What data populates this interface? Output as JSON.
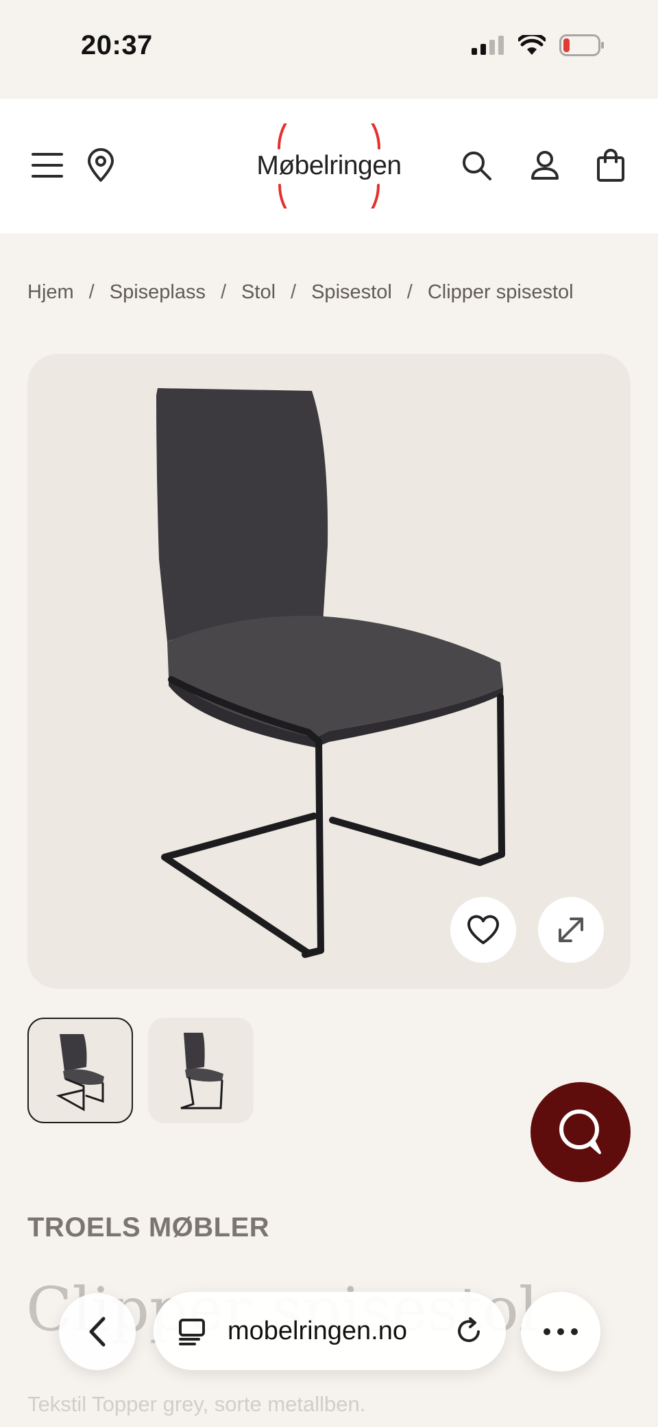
{
  "status_bar": {
    "time": "20:37",
    "icons": [
      "cellular-signal-icon",
      "wifi-icon",
      "battery-low-icon"
    ]
  },
  "header": {
    "menu_icon": "hamburger-menu-icon",
    "location_icon": "location-pin-icon",
    "logo_text": "Møbelringen",
    "search_icon": "search-icon",
    "account_icon": "user-icon",
    "cart_icon": "shopping-bag-icon"
  },
  "breadcrumb": [
    "Hjem",
    "Spiseplass",
    "Stol",
    "Spisestol",
    "Clipper spisestol"
  ],
  "gallery": {
    "favorite_icon": "heart-icon",
    "expand_icon": "expand-arrows-icon",
    "thumbnails": 2,
    "active_thumbnail": 1
  },
  "chat": {
    "icon": "chat-bubble-icon"
  },
  "product": {
    "brand": "TROELS MØBLER",
    "title": "Clipper spisestol",
    "description": "Tekstil Topper grey, sorte metallben."
  },
  "browser": {
    "url": "mobelringen.no",
    "back_icon": "chevron-left-icon",
    "tabs_icon": "reader-icon",
    "reload_icon": "reload-icon",
    "more_icon": "more-dots-icon"
  },
  "colors": {
    "page_bg": "#f6f3ef",
    "header_bg": "#ffffff",
    "gallery_bg": "#ede9e2",
    "logo_ring": "#e3312d",
    "chat_button": "#5e0c0c"
  }
}
